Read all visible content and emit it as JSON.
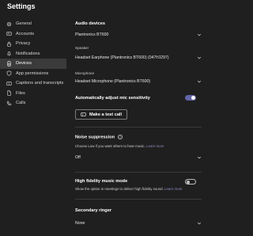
{
  "window": {
    "title": "Settings"
  },
  "sidebar": {
    "items": [
      {
        "label": "General",
        "icon": "gear-icon"
      },
      {
        "label": "Accounts",
        "icon": "accounts-icon"
      },
      {
        "label": "Privacy",
        "icon": "lock-icon"
      },
      {
        "label": "Notifications",
        "icon": "bell-icon"
      },
      {
        "label": "Devices",
        "icon": "speaker-icon",
        "active": true
      },
      {
        "label": "App permissions",
        "icon": "shield-icon"
      },
      {
        "label": "Captions and transcripts",
        "icon": "captions-icon"
      },
      {
        "label": "Files",
        "icon": "file-icon"
      },
      {
        "label": "Calls",
        "icon": "phone-icon"
      }
    ]
  },
  "audio": {
    "heading": "Audio devices",
    "device_value": "Plantronics BT600",
    "speaker_label": "Speaker",
    "speaker_value": "Headset Earphone (Plantronics BT600) (047f:0297)",
    "microphone_label": "Microphone",
    "microphone_value": "Headset Microphone (Plantronics BT600)",
    "auto_adjust_label": "Automatically adjust mic sensitivity",
    "auto_adjust_on": true,
    "test_call_label": "Make a test call"
  },
  "noise": {
    "heading": "Noise suppression",
    "info_glyph": "i",
    "desc": "Choose Low if you want others to hear music.",
    "learn_more": "Learn more",
    "value": "Off"
  },
  "hifi": {
    "heading": "High fidelity music mode",
    "desc": "Show the option in meetings to deliver high fidelity sound.",
    "learn_more": "Learn more",
    "enabled": false
  },
  "ringer": {
    "heading": "Secondary ringer",
    "value": "None"
  },
  "colors": {
    "background": "#1f1f1f",
    "accent": "#6264a7",
    "link": "#8b8cc7",
    "active_nav": "#3b3b3b"
  }
}
